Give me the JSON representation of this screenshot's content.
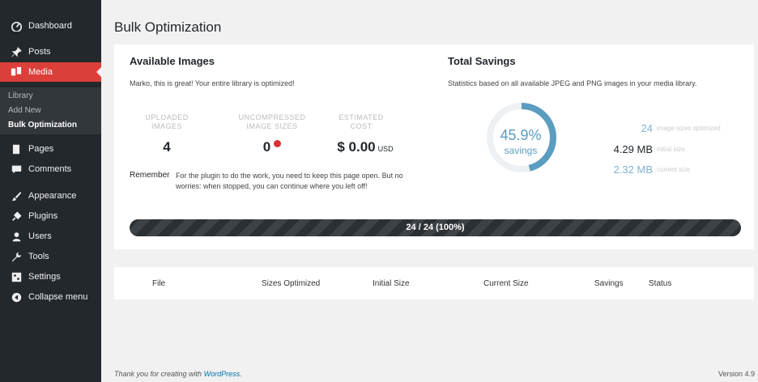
{
  "sidebar": {
    "items": [
      {
        "label": "Dashboard",
        "icon": "dashboard-icon"
      },
      {
        "label": "Posts",
        "icon": "pin-icon"
      },
      {
        "label": "Media",
        "icon": "media-icon"
      },
      {
        "label": "Pages",
        "icon": "pages-icon"
      },
      {
        "label": "Comments",
        "icon": "comment-icon"
      },
      {
        "label": "Appearance",
        "icon": "brush-icon"
      },
      {
        "label": "Plugins",
        "icon": "plugin-icon"
      },
      {
        "label": "Users",
        "icon": "user-icon"
      },
      {
        "label": "Tools",
        "icon": "wrench-icon"
      },
      {
        "label": "Settings",
        "icon": "settings-icon"
      },
      {
        "label": "Collapse menu",
        "icon": "collapse-icon"
      }
    ],
    "submenu": [
      "Library",
      "Add New",
      "Bulk Optimization"
    ],
    "accent": "#dc3f3a"
  },
  "page": {
    "title": "Bulk Optimization"
  },
  "available": {
    "heading": "Available Images",
    "message": "Marko, this is great! Your entire library is optimized!",
    "stats": [
      {
        "label_line1": "UPLOADED",
        "label_line2": "IMAGES",
        "value": "4"
      },
      {
        "label_line1": "UNCOMPRESSED",
        "label_line2": "IMAGE SIZES",
        "value": "0"
      },
      {
        "label_line1": "ESTIMATED",
        "label_line2": "COST",
        "value": "$ 0.00",
        "unit": "USD"
      }
    ],
    "remember_label": "Remember",
    "remember_text": "For the plugin to do the work, you need to keep this page open. But no worries: when stopped, you can continue where you left off!"
  },
  "savings": {
    "heading": "Total Savings",
    "description": "Statistics based on all available JPEG and PNG images in your media library.",
    "percent_text": "45.9%",
    "percent_value": 45.9,
    "percent_label": "savings",
    "rows": [
      {
        "value": "24",
        "label": "image sizes optimized",
        "color": "#7fb3cf"
      },
      {
        "value": "4.29 MB",
        "label": "initial size",
        "color": "#23282d"
      },
      {
        "value": "2.32 MB",
        "label": "current size",
        "color": "#7fb3cf"
      }
    ],
    "accent": "#5b9dc0"
  },
  "progress": {
    "label": "24 / 24 (100%)",
    "fraction": 1.0
  },
  "table": {
    "columns": [
      "File",
      "Sizes Optimized",
      "Initial Size",
      "Current Size",
      "Savings",
      "Status"
    ]
  },
  "footer": {
    "thanks_prefix": "Thank you for creating with",
    "thanks_link": "WordPress",
    "thanks_suffix": ".",
    "version": "Version 4.9"
  }
}
